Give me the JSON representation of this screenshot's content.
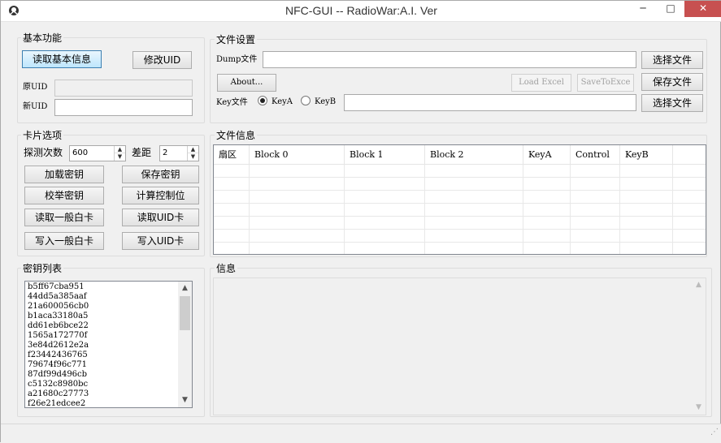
{
  "window": {
    "title": "NFC-GUI  -- RadioWar:A.I. Ver",
    "controls": {
      "minimize": "─",
      "maximize": "□",
      "close": "✕"
    }
  },
  "basic": {
    "title": "基本功能",
    "read_button": "读取基本信息",
    "modify_button": "修改UID",
    "orig_uid_label": "原UID",
    "orig_uid_value": "",
    "new_uid_label": "新UID",
    "new_uid_value": ""
  },
  "file_settings": {
    "title": "文件设置",
    "dump_label": "Dump文件",
    "dump_value": "",
    "choose_file_1": "选择文件",
    "about_button": "About...",
    "load_excel": "Load Excel",
    "save_to_excel": "SaveToExce",
    "save_file": "保存文件",
    "key_file_label": "Key文件",
    "key_a_label": "KeyA",
    "key_b_label": "KeyB",
    "key_selected": "KeyA",
    "key_file_value": "",
    "choose_file_2": "选择文件"
  },
  "card_options": {
    "title": "卡片选项",
    "probe_label": "探测次数",
    "probe_value": "600",
    "diff_label": "差距",
    "diff_value": "2",
    "load_keys": "加载密钥",
    "save_keys": "保存密钥",
    "check_keys": "校举密钥",
    "calc_ctrl": "计算控制位",
    "read_normal": "读取一般白卡",
    "read_uid": "读取UID卡",
    "write_normal": "写入一般白卡",
    "write_uid": "写入UID卡"
  },
  "file_info": {
    "title": "文件信息",
    "columns": [
      "扇区",
      "Block 0",
      "Block 1",
      "Block 2",
      "KeyA",
      "Control",
      "KeyB"
    ]
  },
  "key_list": {
    "title": "密钥列表",
    "keys": [
      "b5ff67cba951",
      "44dd5a385aaf",
      "21a600056cb0",
      "b1aca33180a5",
      "dd61eb6bce22",
      "1565a172770f",
      "3e84d2612e2a",
      "f23442436765",
      "79674f96c771",
      "87df99d496cb",
      "c5132c8980bc",
      "a21680c27773",
      "f26e21edcee2"
    ],
    "scroll_up": "▲",
    "scroll_down": "▼"
  },
  "info": {
    "title": "信息",
    "scroll_up": "▲",
    "scroll_down": "▼"
  },
  "statusbar": {
    "grip": "⋰"
  }
}
